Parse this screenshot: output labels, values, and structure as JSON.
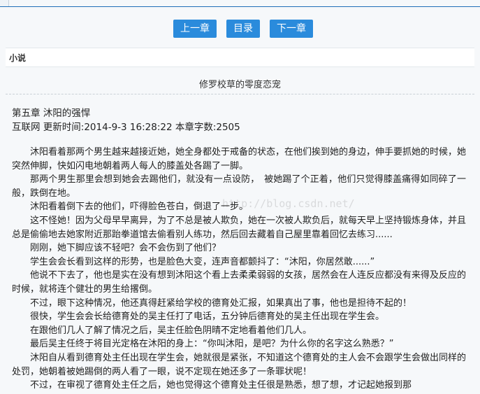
{
  "nav": {
    "prev_label": "上一章",
    "toc_label": "目录",
    "next_label": "下一章"
  },
  "section": {
    "label": "小说"
  },
  "book": {
    "title": "修罗校草的零度恋宠"
  },
  "chapter": {
    "title": "第五章 沐阳的强悍",
    "meta": "互联网 更新时间:2014-9-3 16:28:22 本章字数:2505"
  },
  "content": {
    "paragraphs": [
      "沐阳看着那两个男生越来越接近她，她全身都处于戒备的状态，在他们挨到她的身边，伸手要抓她的时候，她突然伸脚，快如闪电地朝着两人每人的膝盖处各踢了一脚。",
      "那两个男生那里会想到她会去踢他们，就没有一点设防，　被她踢了个正着，他们只觉得膝盖痛得如同碎了一般，跌倒在地。",
      "沐阳看着倒下去的他们，吓得脸色苍白，倒退了一步。",
      "这不怪她！因为父母早早离异，为了不总是被人欺负，她在一次被人欺负后，就每天早上坚持锻炼身体，并且总是偷偷地去她家附近那跆拳道馆去偷看别人练功，然后回去藏着自己屋里靠着回忆去练习......",
      "刚刚，她下脚应该不轻吧？会不会伤到了他们？",
      "学生会会长看到这样的形势，也是脸色大变，连声音都颤抖了：“沐阳，你居然敢......”",
      "他说不下去了，他也是实在没有想到沐阳这个看上去柔柔弱弱的女孩，居然会在人连反应都没有来得及反应的时候，就将连个健壮的男生给撂倒。",
      "不过，眼下这种情况，他还真得赶紧给学校的德育处汇报，如果真出了事，他也是担待不起的！",
      "很快，学生会会长给德育处的吴主任打了电话，五分钟后德育处的吴主任出现在学生会。",
      "在跟他们几人了解了情况之后，吴主任脸色阴晴不定地看着他们几人。",
      "最后吴主任终于将目光定格在沐阳的身上：“你叫沐阳，是吧？为什么你的名字这么熟悉？”",
      "沐阳自从看到德育处主任出现在学生会，她就很是紧张，不知道这个德育处的主人会不会跟学生会做出同样的处罚，她朝着被她踢倒的两人看了一眼，说不定现在她还多了一条罪状呢！",
      "不过，在审视了德育处主任之后，她也觉得这个德育处主任很是熟悉，想了想，才记起她报到那"
    ]
  },
  "watermark": {
    "text": "http://blog.csdn.net/"
  },
  "colors": {
    "button_bg": "#2a8bdc",
    "button_text": "#ffffff",
    "page_bg": "#f6f8fa"
  }
}
